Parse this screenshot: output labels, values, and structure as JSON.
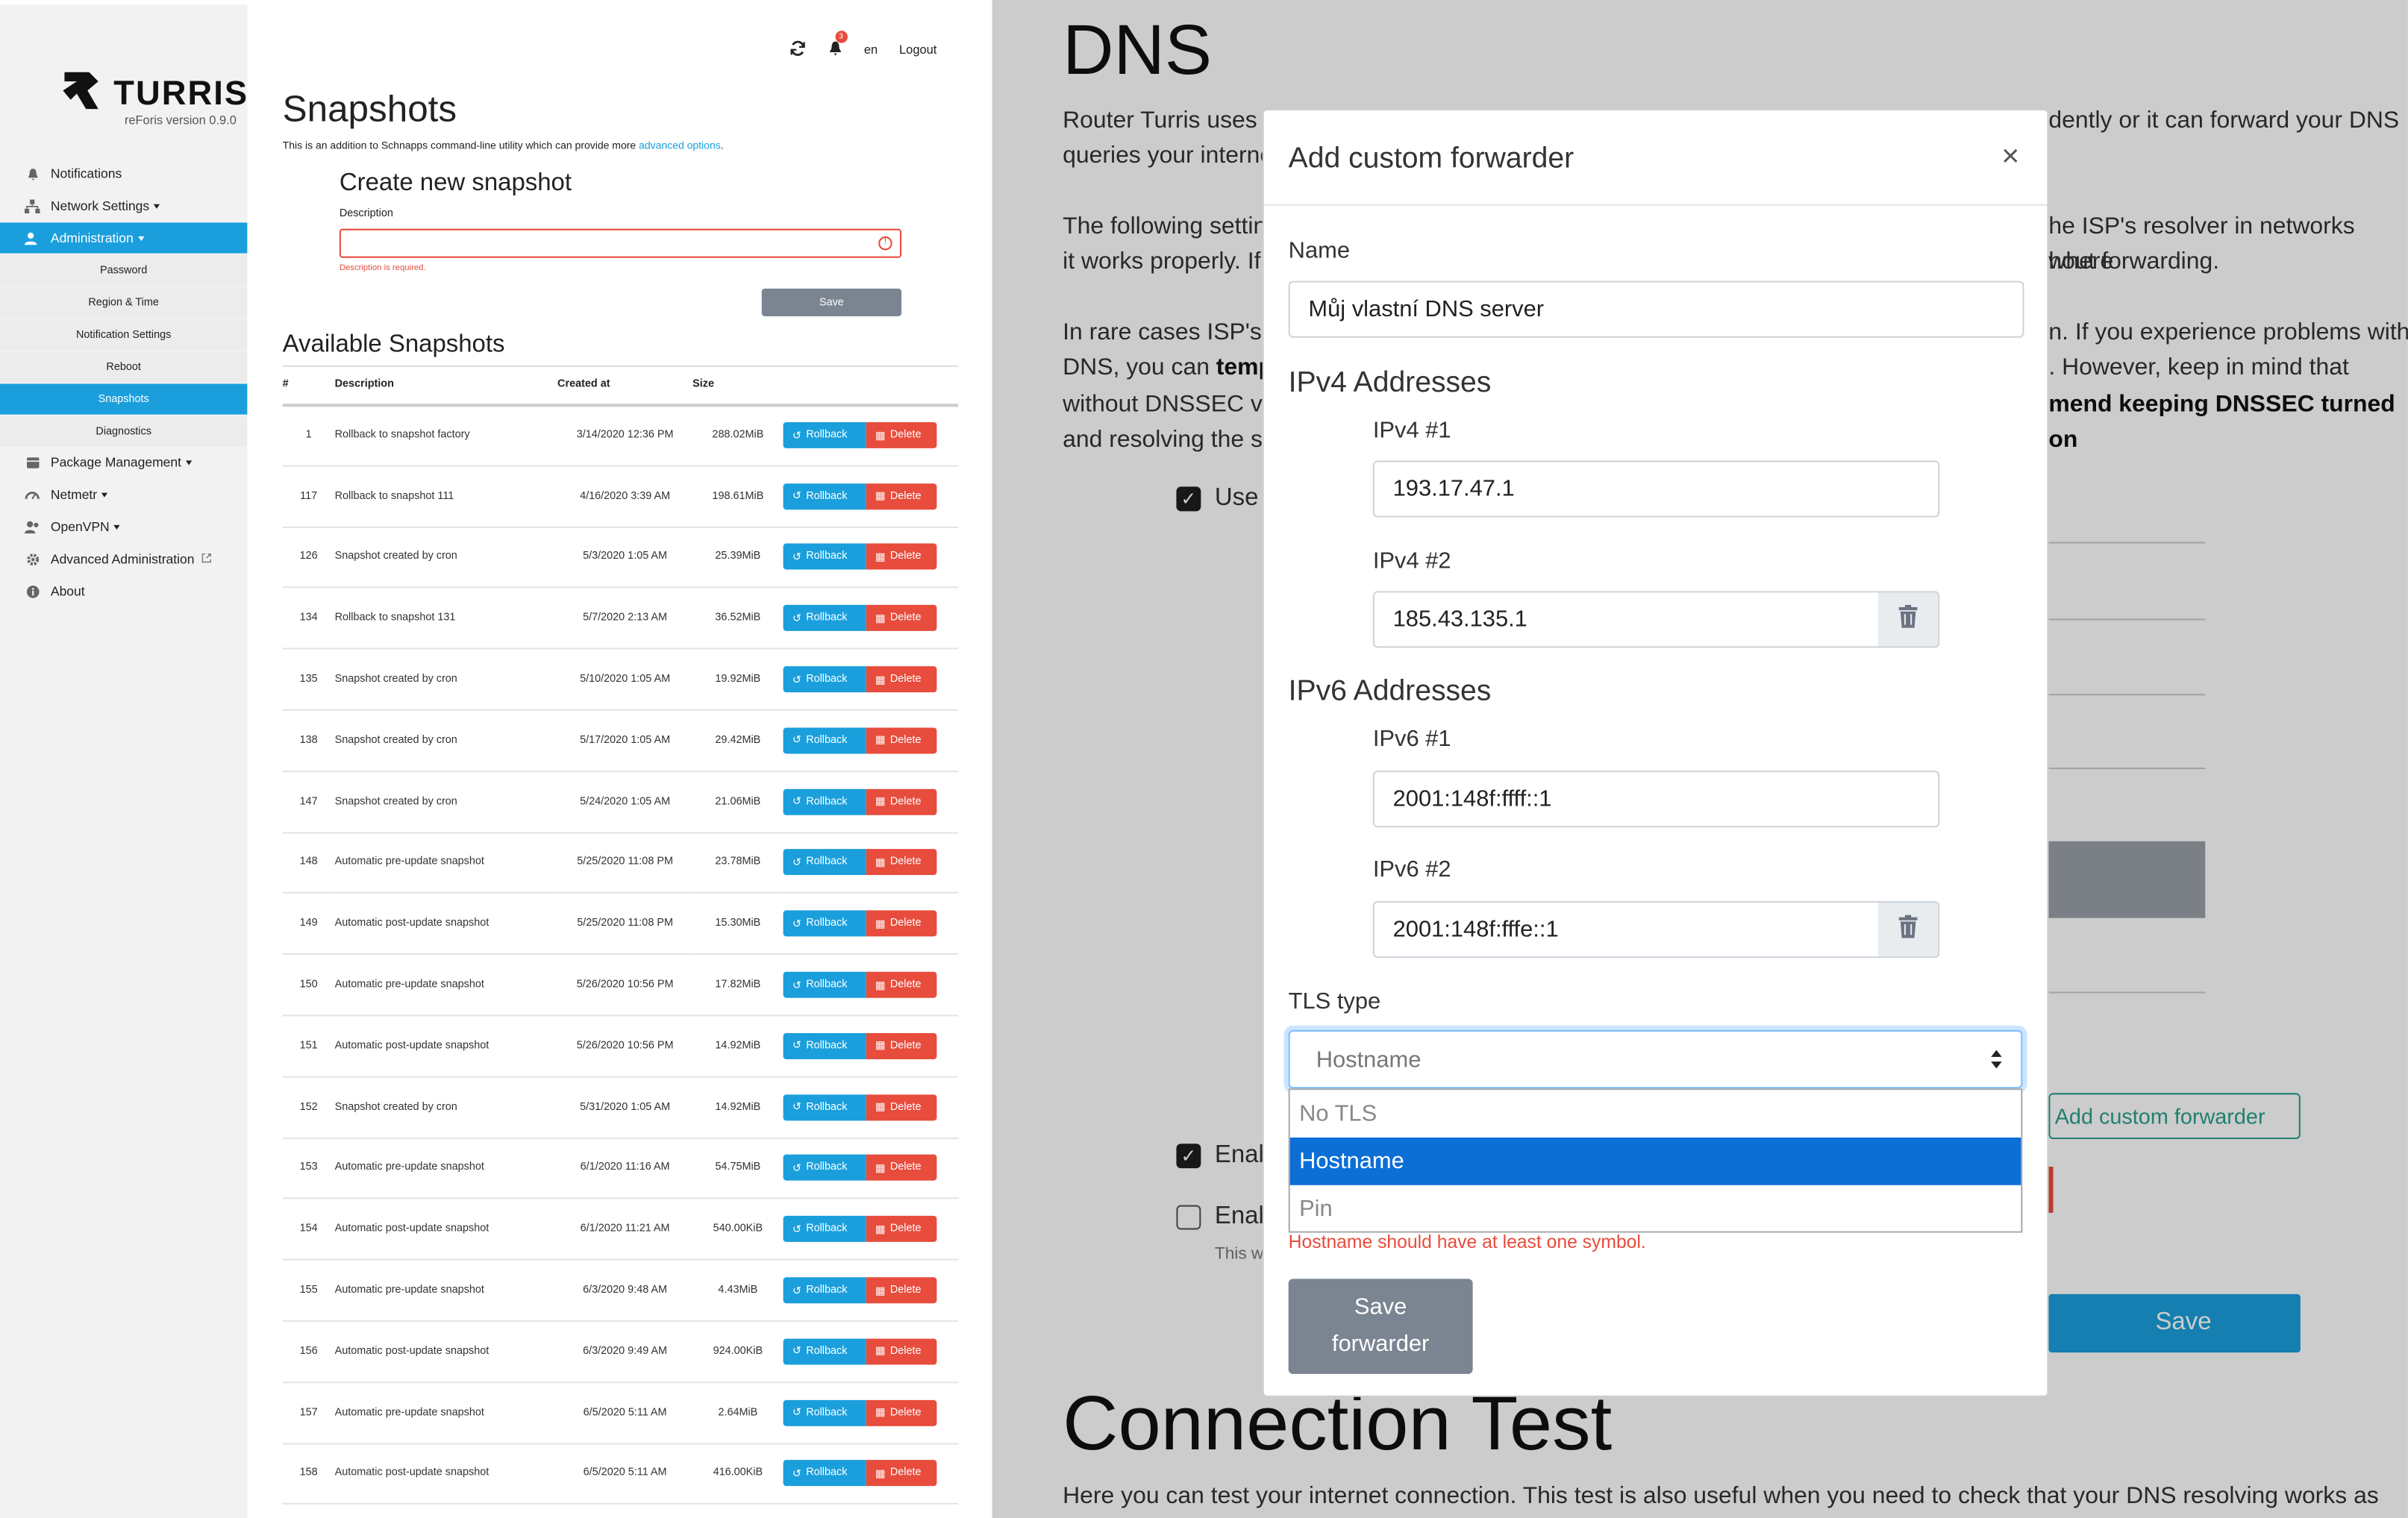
{
  "left": {
    "brand": {
      "name": "TURRIS",
      "version": "reForis version 0.9.0"
    },
    "topbar": {
      "lang": "en",
      "logout": "Logout",
      "notif_count": "3"
    },
    "nav": [
      {
        "label": "Notifications"
      },
      {
        "label": "Network Settings"
      },
      {
        "label": "Administration"
      },
      {
        "label": "Package Management"
      },
      {
        "label": "Netmetr"
      },
      {
        "label": "OpenVPN"
      },
      {
        "label": "Advanced Administration"
      },
      {
        "label": "About"
      }
    ],
    "subnav": [
      {
        "label": "Password"
      },
      {
        "label": "Region & Time"
      },
      {
        "label": "Notification Settings"
      },
      {
        "label": "Reboot"
      },
      {
        "label": "Snapshots"
      },
      {
        "label": "Diagnostics"
      }
    ],
    "page": {
      "title": "Snapshots",
      "intro": "This is an addition to Schnapps command-line utility which can provide more ",
      "intro_link": "advanced options",
      "intro_end": ".",
      "create_title": "Create new snapshot",
      "desc_label": "Description",
      "desc_error": "Description is required.",
      "save": "Save",
      "available_title": "Available Snapshots"
    },
    "table": {
      "headers": [
        "#",
        "Description",
        "Created at",
        "Size"
      ],
      "rollback": "Rollback",
      "delete": "Delete",
      "rows": [
        {
          "n": "1",
          "desc": "Rollback to snapshot factory",
          "date": "3/14/2020 12:36 PM",
          "size": "288.02MiB"
        },
        {
          "n": "117",
          "desc": "Rollback to snapshot 111",
          "date": "4/16/2020 3:39 AM",
          "size": "198.61MiB"
        },
        {
          "n": "126",
          "desc": "Snapshot created by cron",
          "date": "5/3/2020 1:05 AM",
          "size": "25.39MiB"
        },
        {
          "n": "134",
          "desc": "Rollback to snapshot 131",
          "date": "5/7/2020 2:13 AM",
          "size": "36.52MiB"
        },
        {
          "n": "135",
          "desc": "Snapshot created by cron",
          "date": "5/10/2020 1:05 AM",
          "size": "19.92MiB"
        },
        {
          "n": "138",
          "desc": "Snapshot created by cron",
          "date": "5/17/2020 1:05 AM",
          "size": "29.42MiB"
        },
        {
          "n": "147",
          "desc": "Snapshot created by cron",
          "date": "5/24/2020 1:05 AM",
          "size": "21.06MiB"
        },
        {
          "n": "148",
          "desc": "Automatic pre-update snapshot",
          "date": "5/25/2020 11:08 PM",
          "size": "23.78MiB"
        },
        {
          "n": "149",
          "desc": "Automatic post-update snapshot",
          "date": "5/25/2020 11:08 PM",
          "size": "15.30MiB"
        },
        {
          "n": "150",
          "desc": "Automatic pre-update snapshot",
          "date": "5/26/2020 10:56 PM",
          "size": "17.82MiB"
        },
        {
          "n": "151",
          "desc": "Automatic post-update snapshot",
          "date": "5/26/2020 10:56 PM",
          "size": "14.92MiB"
        },
        {
          "n": "152",
          "desc": "Snapshot created by cron",
          "date": "5/31/2020 1:05 AM",
          "size": "14.92MiB"
        },
        {
          "n": "153",
          "desc": "Automatic pre-update snapshot",
          "date": "6/1/2020 11:16 AM",
          "size": "54.75MiB"
        },
        {
          "n": "154",
          "desc": "Automatic post-update snapshot",
          "date": "6/1/2020 11:21 AM",
          "size": "540.00KiB"
        },
        {
          "n": "155",
          "desc": "Automatic pre-update snapshot",
          "date": "6/3/2020 9:48 AM",
          "size": "4.43MiB"
        },
        {
          "n": "156",
          "desc": "Automatic post-update snapshot",
          "date": "6/3/2020 9:49 AM",
          "size": "924.00KiB"
        },
        {
          "n": "157",
          "desc": "Automatic pre-update snapshot",
          "date": "6/5/2020 5:11 AM",
          "size": "2.64MiB"
        },
        {
          "n": "158",
          "desc": "Automatic post-update snapshot",
          "date": "6/5/2020 5:11 AM",
          "size": "416.00KiB"
        }
      ]
    }
  },
  "right": {
    "bg": {
      "title": "DNS",
      "p1a": "Router Turris uses i",
      "p1b": "dently or it can forward your DNS",
      "p1c": "queries your interne",
      "p2a": "The following settin",
      "p2b": "he ISP's resolver in networks where",
      "p2c": "it works properly. If",
      "p2d": "hout forwarding.",
      "p3a": "In rare cases ISP's h",
      "p3b": "n. If you experience problems with",
      "p3c": "DNS, you can ",
      "p3c_bold": "temp",
      "p3d": ". However, keep in mind that",
      "p3e": "without DNSSEC va",
      "p3f": "mend keeping DNSSEC turned on",
      "p3g": "and resolving the si",
      "use_label": "Use f",
      "enable1": "Enab",
      "enable2": "Enab",
      "this_text": "This w",
      "add_forwarder": "Add custom forwarder",
      "save": "Save",
      "conn_title": "Connection Test",
      "conn_text": "Here you can test your internet connection. This test is also useful when you need to check that your DNS resolving works as"
    },
    "modal": {
      "title": "Add custom forwarder",
      "close": "×",
      "name_label": "Name",
      "name_value": "Můj vlastní DNS server",
      "ipv4_heading": "IPv4 Addresses",
      "ipv4_1_label": "IPv4 #1",
      "ipv4_1_value": "193.17.47.1",
      "ipv4_2_label": "IPv4 #2",
      "ipv4_2_value": "185.43.135.1",
      "ipv6_heading": "IPv6 Addresses",
      "ipv6_1_label": "IPv6 #1",
      "ipv6_1_value": "2001:148f:ffff::1",
      "ipv6_2_label": "IPv6 #2",
      "ipv6_2_value": "2001:148f:fffe::1",
      "tls_label": "TLS type",
      "tls_value": "Hostname",
      "tls_options": [
        "No TLS",
        "Hostname",
        "Pin"
      ],
      "tls_selected": "Hostname",
      "tls_error": "Hostname should have at least one symbol.",
      "save_line1": "Save",
      "save_line2": "forwarder"
    }
  }
}
